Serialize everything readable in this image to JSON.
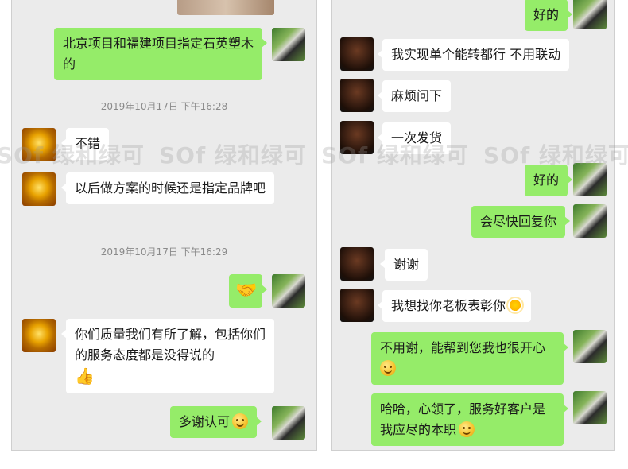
{
  "left": {
    "messages": [
      {
        "text": "北京项目和福建项目指定石英塑木的"
      },
      {
        "text": "不错"
      },
      {
        "text": "以后做方案的时候还是指定品牌吧"
      },
      {
        "text": "你们质量我们有所了解，包括你们的服务态度都是没得说的"
      },
      {
        "text": "多谢认可"
      }
    ],
    "timestamps": [
      "2019年10月17日 下午16:28",
      "2019年10月17日 下午16:29"
    ]
  },
  "right": {
    "messages": [
      {
        "text": "好的"
      },
      {
        "text": "我实现单个能转都行 不用联动"
      },
      {
        "text": "麻烦问下"
      },
      {
        "text": "一次发货"
      },
      {
        "text": "好的"
      },
      {
        "text": "会尽快回复你"
      },
      {
        "text": "谢谢"
      },
      {
        "text": "我想找你老板表彰你"
      },
      {
        "text": "不用谢，能帮到您我也很开心"
      },
      {
        "text": "哈哈，心领了，服务好客户是我应尽的本职"
      }
    ]
  },
  "watermark": {
    "text": "SOf 绿和绿可"
  },
  "icons": {
    "smile": "smile-emoji-icon",
    "thumb": "thumbs-up-icon",
    "handshake": "handshake-icon",
    "sun": "sun-emoji-icon"
  },
  "colors": {
    "my_bubble": "#95ec69",
    "their_bubble": "#ffffff",
    "chat_bg": "#ebebeb",
    "timestamp": "#8a8a8a"
  }
}
